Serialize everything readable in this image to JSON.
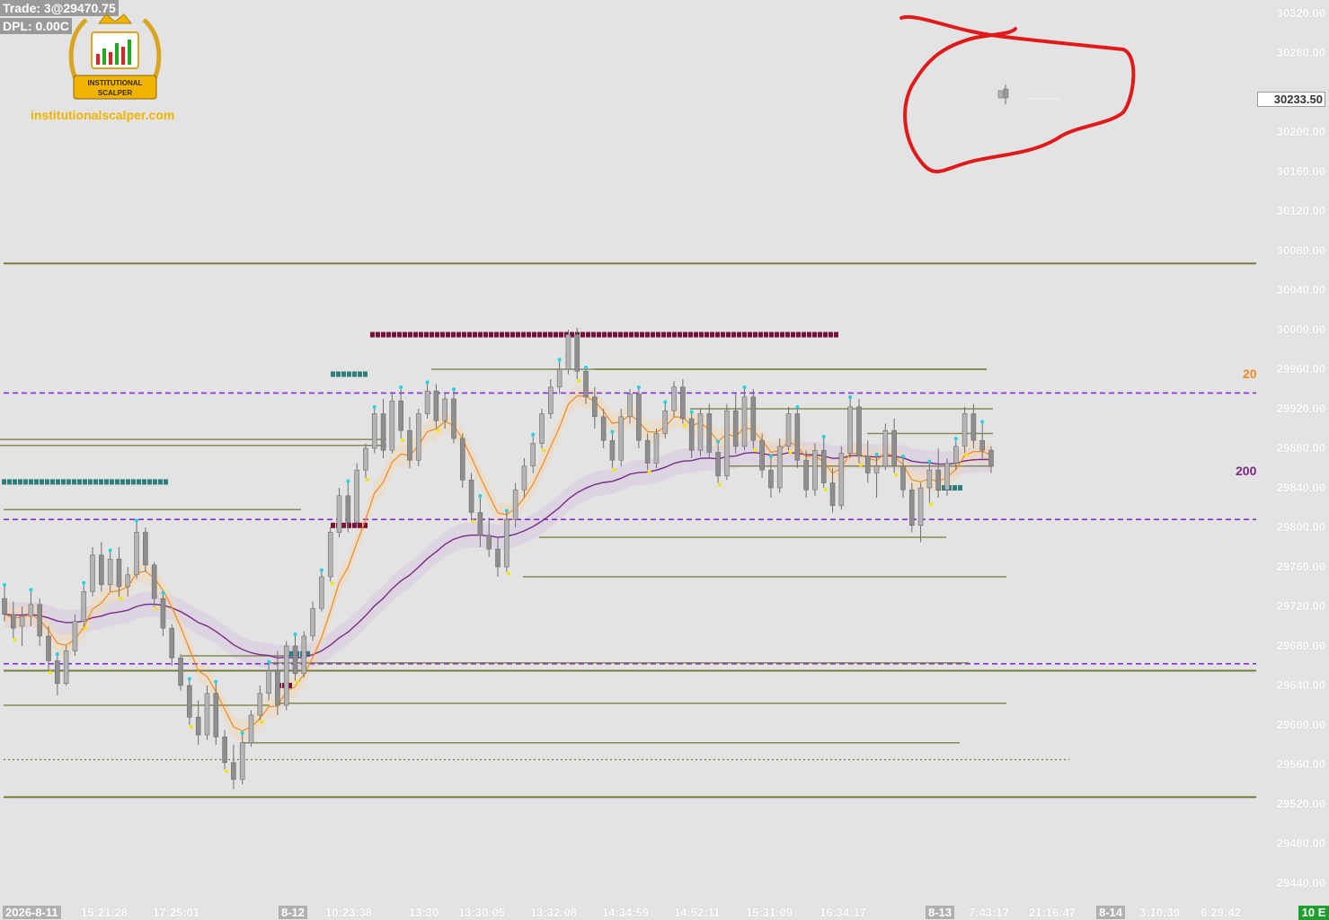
{
  "hud": {
    "trade": "Trade: 3@29470.75",
    "dpl": "DPL: 0.00C"
  },
  "logo": {
    "line1": "INSTITUTIONAL",
    "line2": "SCALPER",
    "url": "institutionalscalper.com"
  },
  "colors": {
    "background": "#e3e3e3",
    "candle": "#8e8e8e",
    "level_line": "#7a7a3c",
    "dashed_purple": "#8a2be2",
    "ema20": "#f08a20",
    "ema200": "#7a2a8a",
    "annotation_circle": "#e0191a",
    "cyan_dot": "#1fd3e0",
    "yellow_dot": "#f5e400",
    "maroon_zone": "#7a0f3a",
    "teal_zone": "#2f7f7f"
  },
  "axis": {
    "y_ticks": [
      "30320.00",
      "30280.00",
      "30233.50",
      "30200.00",
      "30160.00",
      "30120.00",
      "30080.00",
      "30040.00",
      "30000.00",
      "29960.00",
      "29920.00",
      "29880.00",
      "29840.00",
      "29800.00",
      "29760.00",
      "29720.00",
      "29680.00",
      "29640.00",
      "29600.00",
      "29560.00",
      "29520.00",
      "29480.00",
      "29440.00"
    ],
    "current_price": "30233.50",
    "x_ticks": [
      {
        "label": "2026-8-11",
        "date": true
      },
      {
        "label": "15:21:28",
        "date": false
      },
      {
        "label": "17:25:01",
        "date": false
      },
      {
        "label": "8-12",
        "date": true
      },
      {
        "label": "10:23:38",
        "date": false
      },
      {
        "label": "13:30",
        "date": false
      },
      {
        "label": "13:30:05",
        "date": false
      },
      {
        "label": "13:32:08",
        "date": false
      },
      {
        "label": "14:34:59",
        "date": false
      },
      {
        "label": "14:52:11",
        "date": false
      },
      {
        "label": "15:31:09",
        "date": false
      },
      {
        "label": "16:34:17",
        "date": false
      },
      {
        "label": "8-13",
        "date": true
      },
      {
        "label": "7:43:17",
        "date": false
      },
      {
        "label": "21:16:47",
        "date": false
      },
      {
        "label": "8-14",
        "date": true
      },
      {
        "label": "3:10:39",
        "date": false
      },
      {
        "label": "6:29:42",
        "date": false
      }
    ],
    "corner": "10 E"
  },
  "ma_labels": {
    "fast": "20",
    "slow": "200"
  },
  "chart_data": {
    "type": "candlestick",
    "ylim": [
      29420,
      30340
    ],
    "current_price": 30233.5,
    "levels": [
      {
        "price": 30067,
        "style": "solid",
        "color": "olive"
      },
      {
        "price": 29936,
        "style": "dashed",
        "color": "purple"
      },
      {
        "price": 29808,
        "style": "dashed",
        "color": "purple"
      },
      {
        "price": 29662,
        "style": "dashed",
        "color": "purple"
      },
      {
        "price": 29655,
        "style": "solid",
        "color": "olive"
      },
      {
        "price": 29527,
        "style": "solid",
        "color": "olive"
      }
    ],
    "series": [
      {
        "name": "20",
        "color": "#f08a20"
      },
      {
        "name": "200",
        "color": "#7a2a8a"
      }
    ],
    "candles": [
      {
        "o": 29728,
        "h": 29740,
        "l": 29705,
        "c": 29712
      },
      {
        "o": 29712,
        "h": 29725,
        "l": 29688,
        "c": 29698
      },
      {
        "o": 29700,
        "h": 29720,
        "l": 29680,
        "c": 29710
      },
      {
        "o": 29710,
        "h": 29735,
        "l": 29700,
        "c": 29722
      },
      {
        "o": 29722,
        "h": 29728,
        "l": 29680,
        "c": 29690
      },
      {
        "o": 29690,
        "h": 29700,
        "l": 29655,
        "c": 29665
      },
      {
        "o": 29665,
        "h": 29670,
        "l": 29630,
        "c": 29642
      },
      {
        "o": 29642,
        "h": 29680,
        "l": 29640,
        "c": 29675
      },
      {
        "o": 29675,
        "h": 29712,
        "l": 29670,
        "c": 29705
      },
      {
        "o": 29705,
        "h": 29742,
        "l": 29700,
        "c": 29735
      },
      {
        "o": 29735,
        "h": 29780,
        "l": 29730,
        "c": 29772
      },
      {
        "o": 29772,
        "h": 29785,
        "l": 29735,
        "c": 29742
      },
      {
        "o": 29742,
        "h": 29775,
        "l": 29735,
        "c": 29768
      },
      {
        "o": 29768,
        "h": 29780,
        "l": 29730,
        "c": 29740
      },
      {
        "o": 29740,
        "h": 29760,
        "l": 29730,
        "c": 29752
      },
      {
        "o": 29752,
        "h": 29805,
        "l": 29748,
        "c": 29795
      },
      {
        "o": 29795,
        "h": 29800,
        "l": 29755,
        "c": 29762
      },
      {
        "o": 29762,
        "h": 29765,
        "l": 29720,
        "c": 29728
      },
      {
        "o": 29728,
        "h": 29732,
        "l": 29690,
        "c": 29698
      },
      {
        "o": 29698,
        "h": 29702,
        "l": 29660,
        "c": 29668
      },
      {
        "o": 29668,
        "h": 29672,
        "l": 29635,
        "c": 29640
      },
      {
        "o": 29640,
        "h": 29645,
        "l": 29600,
        "c": 29608
      },
      {
        "o": 29608,
        "h": 29625,
        "l": 29580,
        "c": 29590
      },
      {
        "o": 29590,
        "h": 29640,
        "l": 29585,
        "c": 29632
      },
      {
        "o": 29632,
        "h": 29642,
        "l": 29580,
        "c": 29588
      },
      {
        "o": 29588,
        "h": 29595,
        "l": 29555,
        "c": 29562
      },
      {
        "o": 29562,
        "h": 29580,
        "l": 29535,
        "c": 29545
      },
      {
        "o": 29545,
        "h": 29590,
        "l": 29540,
        "c": 29582
      },
      {
        "o": 29582,
        "h": 29615,
        "l": 29578,
        "c": 29610
      },
      {
        "o": 29610,
        "h": 29640,
        "l": 29605,
        "c": 29632
      },
      {
        "o": 29632,
        "h": 29662,
        "l": 29625,
        "c": 29655
      },
      {
        "o": 29655,
        "h": 29675,
        "l": 29610,
        "c": 29620
      },
      {
        "o": 29620,
        "h": 29685,
        "l": 29615,
        "c": 29680
      },
      {
        "o": 29680,
        "h": 29690,
        "l": 29645,
        "c": 29652
      },
      {
        "o": 29652,
        "h": 29695,
        "l": 29648,
        "c": 29690
      },
      {
        "o": 29690,
        "h": 29725,
        "l": 29685,
        "c": 29718
      },
      {
        "o": 29718,
        "h": 29755,
        "l": 29715,
        "c": 29750
      },
      {
        "o": 29750,
        "h": 29800,
        "l": 29745,
        "c": 29795
      },
      {
        "o": 29795,
        "h": 29840,
        "l": 29790,
        "c": 29832
      },
      {
        "o": 29832,
        "h": 29845,
        "l": 29795,
        "c": 29805
      },
      {
        "o": 29805,
        "h": 29865,
        "l": 29800,
        "c": 29858
      },
      {
        "o": 29858,
        "h": 29885,
        "l": 29850,
        "c": 29880
      },
      {
        "o": 29880,
        "h": 29920,
        "l": 29875,
        "c": 29915
      },
      {
        "o": 29915,
        "h": 29930,
        "l": 29870,
        "c": 29878
      },
      {
        "o": 29878,
        "h": 29935,
        "l": 29875,
        "c": 29928
      },
      {
        "o": 29928,
        "h": 29940,
        "l": 29890,
        "c": 29898
      },
      {
        "o": 29898,
        "h": 29912,
        "l": 29860,
        "c": 29868
      },
      {
        "o": 29868,
        "h": 29920,
        "l": 29862,
        "c": 29915
      },
      {
        "o": 29915,
        "h": 29945,
        "l": 29910,
        "c": 29938
      },
      {
        "o": 29938,
        "h": 29945,
        "l": 29900,
        "c": 29908
      },
      {
        "o": 29908,
        "h": 29935,
        "l": 29900,
        "c": 29930
      },
      {
        "o": 29930,
        "h": 29938,
        "l": 29885,
        "c": 29890
      },
      {
        "o": 29890,
        "h": 29895,
        "l": 29840,
        "c": 29848
      },
      {
        "o": 29848,
        "h": 29855,
        "l": 29808,
        "c": 29815
      },
      {
        "o": 29815,
        "h": 29830,
        "l": 29780,
        "c": 29792
      },
      {
        "o": 29792,
        "h": 29810,
        "l": 29770,
        "c": 29778
      },
      {
        "o": 29778,
        "h": 29790,
        "l": 29750,
        "c": 29760
      },
      {
        "o": 29760,
        "h": 29815,
        "l": 29755,
        "c": 29808
      },
      {
        "o": 29808,
        "h": 29845,
        "l": 29800,
        "c": 29838
      },
      {
        "o": 29838,
        "h": 29870,
        "l": 29830,
        "c": 29862
      },
      {
        "o": 29862,
        "h": 29892,
        "l": 29855,
        "c": 29885
      },
      {
        "o": 29885,
        "h": 29920,
        "l": 29880,
        "c": 29915
      },
      {
        "o": 29915,
        "h": 29950,
        "l": 29910,
        "c": 29942
      },
      {
        "o": 29942,
        "h": 29968,
        "l": 29935,
        "c": 29960
      },
      {
        "o": 29960,
        "h": 30000,
        "l": 29955,
        "c": 29995
      },
      {
        "o": 29995,
        "h": 30002,
        "l": 29950,
        "c": 29958
      },
      {
        "o": 29958,
        "h": 29960,
        "l": 29925,
        "c": 29932
      },
      {
        "o": 29932,
        "h": 29942,
        "l": 29900,
        "c": 29912
      },
      {
        "o": 29912,
        "h": 29920,
        "l": 29880,
        "c": 29888
      },
      {
        "o": 29888,
        "h": 29895,
        "l": 29860,
        "c": 29868
      },
      {
        "o": 29868,
        "h": 29920,
        "l": 29862,
        "c": 29912
      },
      {
        "o": 29912,
        "h": 29940,
        "l": 29905,
        "c": 29935
      },
      {
        "o": 29935,
        "h": 29940,
        "l": 29880,
        "c": 29888
      },
      {
        "o": 29888,
        "h": 29895,
        "l": 29858,
        "c": 29865
      },
      {
        "o": 29865,
        "h": 29900,
        "l": 29860,
        "c": 29895
      },
      {
        "o": 29895,
        "h": 29925,
        "l": 29890,
        "c": 29918
      },
      {
        "o": 29918,
        "h": 29948,
        "l": 29912,
        "c": 29942
      },
      {
        "o": 29942,
        "h": 29950,
        "l": 29905,
        "c": 29910
      },
      {
        "o": 29910,
        "h": 29915,
        "l": 29870,
        "c": 29878
      },
      {
        "o": 29878,
        "h": 29920,
        "l": 29872,
        "c": 29915
      },
      {
        "o": 29915,
        "h": 29925,
        "l": 29870,
        "c": 29876
      },
      {
        "o": 29876,
        "h": 29885,
        "l": 29845,
        "c": 29852
      },
      {
        "o": 29852,
        "h": 29925,
        "l": 29848,
        "c": 29918
      },
      {
        "o": 29918,
        "h": 29935,
        "l": 29875,
        "c": 29882
      },
      {
        "o": 29882,
        "h": 29940,
        "l": 29878,
        "c": 29932
      },
      {
        "o": 29932,
        "h": 29940,
        "l": 29880,
        "c": 29888
      },
      {
        "o": 29888,
        "h": 29895,
        "l": 29850,
        "c": 29858
      },
      {
        "o": 29858,
        "h": 29870,
        "l": 29830,
        "c": 29840
      },
      {
        "o": 29840,
        "h": 29890,
        "l": 29835,
        "c": 29882
      },
      {
        "o": 29882,
        "h": 29922,
        "l": 29878,
        "c": 29915
      },
      {
        "o": 29915,
        "h": 29920,
        "l": 29860,
        "c": 29868
      },
      {
        "o": 29868,
        "h": 29878,
        "l": 29830,
        "c": 29838
      },
      {
        "o": 29838,
        "h": 29885,
        "l": 29832,
        "c": 29878
      },
      {
        "o": 29878,
        "h": 29890,
        "l": 29840,
        "c": 29845
      },
      {
        "o": 29845,
        "h": 29860,
        "l": 29815,
        "c": 29822
      },
      {
        "o": 29822,
        "h": 29882,
        "l": 29818,
        "c": 29875
      },
      {
        "o": 29875,
        "h": 29930,
        "l": 29870,
        "c": 29922
      },
      {
        "o": 29922,
        "h": 29930,
        "l": 29865,
        "c": 29872
      },
      {
        "o": 29872,
        "h": 29888,
        "l": 29845,
        "c": 29855
      },
      {
        "o": 29855,
        "h": 29872,
        "l": 29830,
        "c": 29862
      },
      {
        "o": 29862,
        "h": 29905,
        "l": 29858,
        "c": 29898
      },
      {
        "o": 29898,
        "h": 29910,
        "l": 29855,
        "c": 29862
      },
      {
        "o": 29862,
        "h": 29870,
        "l": 29830,
        "c": 29838
      },
      {
        "o": 29838,
        "h": 29845,
        "l": 29795,
        "c": 29802
      },
      {
        "o": 29802,
        "h": 29845,
        "l": 29785,
        "c": 29840
      },
      {
        "o": 29840,
        "h": 29865,
        "l": 29825,
        "c": 29858
      },
      {
        "o": 29858,
        "h": 29880,
        "l": 29830,
        "c": 29838
      },
      {
        "o": 29838,
        "h": 29870,
        "l": 29832,
        "c": 29865
      },
      {
        "o": 29865,
        "h": 29888,
        "l": 29858,
        "c": 29882
      },
      {
        "o": 29882,
        "h": 29922,
        "l": 29875,
        "c": 29915
      },
      {
        "o": 29915,
        "h": 29925,
        "l": 29880,
        "c": 29888
      },
      {
        "o": 29888,
        "h": 29905,
        "l": 29870,
        "c": 29878
      },
      {
        "o": 29878,
        "h": 29882,
        "l": 29855,
        "c": 29862
      }
    ],
    "last_candle": {
      "o": 30240,
      "h": 30248,
      "l": 30228,
      "c": 30233.5
    }
  }
}
